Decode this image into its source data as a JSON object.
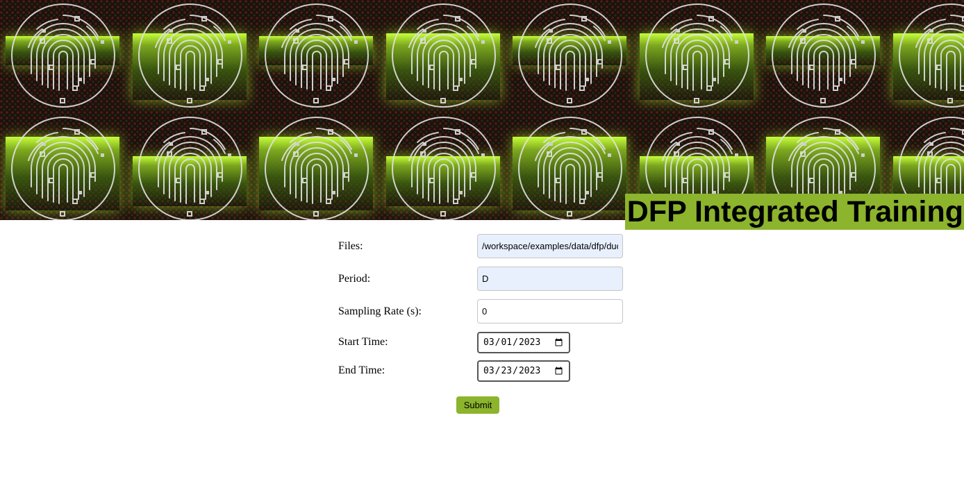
{
  "header": {
    "title": "DFP Integrated Training",
    "banner_icon": "fingerprint-icon",
    "banner_accent": "#8cb42c"
  },
  "form": {
    "files": {
      "label": "Files:",
      "value": "/workspace/examples/data/dfp/duo-training-data/*.json"
    },
    "period": {
      "label": "Period:",
      "value": "D"
    },
    "sampling_rate": {
      "label": "Sampling Rate (s):",
      "value": "0"
    },
    "start_time": {
      "label": "Start Time:",
      "value": "2023-03-01"
    },
    "end_time": {
      "label": "End Time:",
      "value": "2023-03-23"
    },
    "submit_label": "Submit"
  }
}
